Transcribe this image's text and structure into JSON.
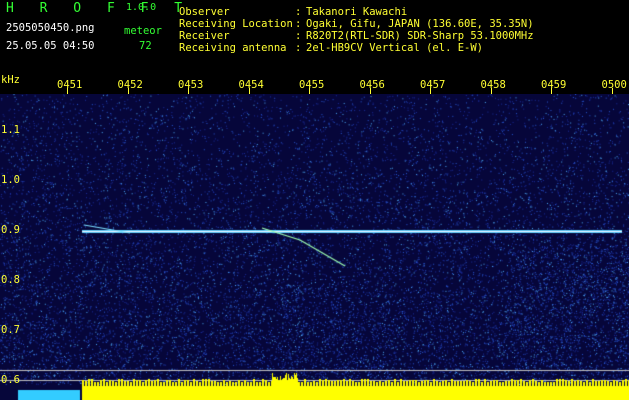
{
  "app": {
    "name": "H R O F F T",
    "version": "1.0.0"
  },
  "file": {
    "name": "2505050450.png",
    "datetime": "25.05.05 04:50"
  },
  "detection": {
    "label": "meteor",
    "count": "72"
  },
  "info": [
    {
      "key": "Observer",
      "value": "Takanori Kawachi"
    },
    {
      "key": "Receiving Location",
      "value": "Ogaki, Gifu, JAPAN (136.60E, 35.35N)"
    },
    {
      "key": "Receiver",
      "value": "R820T2(RTL-SDR) SDR-Sharp 53.1000MHz"
    },
    {
      "key": "Receiving antenna",
      "value": "2el-HB9CV Vertical (el. E-W)"
    }
  ],
  "time_ticks": [
    "0451",
    "0452",
    "0453",
    "0454",
    "0455",
    "0456",
    "0457",
    "0458",
    "0459",
    "0500"
  ],
  "y_unit": "kHz",
  "y_ticks": [
    "1.1",
    "1.0",
    "0.9",
    "0.8",
    "0.7",
    "0.6"
  ],
  "colors": {
    "label": "#ffff33",
    "header": "#33ff33",
    "carrier": "#e8f0ff",
    "background": "#06063a"
  }
}
